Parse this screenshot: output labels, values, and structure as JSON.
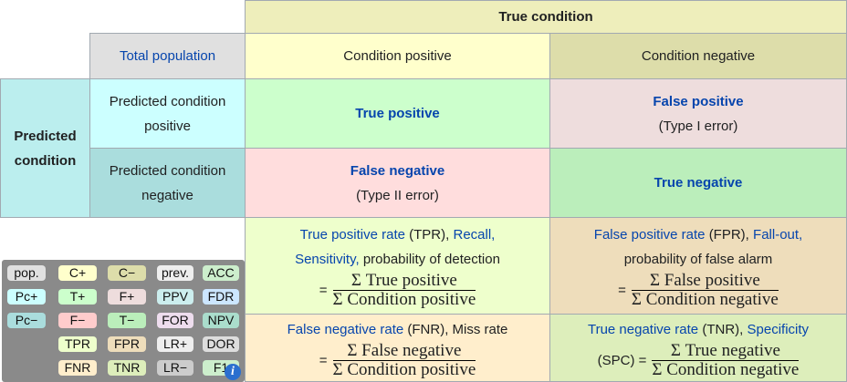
{
  "header": {
    "true_condition": "True condition",
    "total_population": "Total population",
    "condition_positive": "Condition positive",
    "condition_negative": "Condition negative"
  },
  "rows": {
    "predicted_condition": "Predicted condition",
    "pred_pos": "Predicted condition positive",
    "pred_neg": "Predicted condition negative"
  },
  "cells": {
    "tp": "True positive",
    "fp": "False positive",
    "fp_note": "(Type I error)",
    "fn": "False negative",
    "fn_note": "(Type II error)",
    "tn": "True negative"
  },
  "tpr": {
    "name": "True positive rate",
    "abbr": "(TPR),",
    "recall": "Recall,",
    "sens": "Sensitivity,",
    "rest": "probability of detection",
    "eq": "=",
    "num": "Σ True positive",
    "den": "Σ Condition positive"
  },
  "fpr": {
    "name": "False positive rate",
    "abbr": "(FPR),",
    "fallout": "Fall-out,",
    "rest": "probability of false alarm",
    "eq": "=",
    "num": "Σ False positive",
    "den": "Σ Condition negative"
  },
  "fnr": {
    "name": "False negative rate",
    "abbr": "(FNR), Miss rate",
    "eq": "=",
    "num": "Σ False negative",
    "den": "Σ Condition positive"
  },
  "tnr": {
    "name": "True negative rate",
    "abbr": "(TNR),",
    "spec": "Specificity",
    "pre": "(SPC) =",
    "num": "Σ True negative",
    "den": "Σ Condition negative"
  },
  "diagram": {
    "labels": [
      "pop.",
      "C+",
      "C−",
      "prev.",
      "ACC",
      "Pc+",
      "T+",
      "F+",
      "PPV",
      "FDR",
      "Pc−",
      "F−",
      "T−",
      "FOR",
      "NPV",
      "TPR",
      "FPR",
      "LR+",
      "DOR",
      "FNR",
      "TNR",
      "LR−",
      "F1"
    ],
    "info": "i"
  }
}
